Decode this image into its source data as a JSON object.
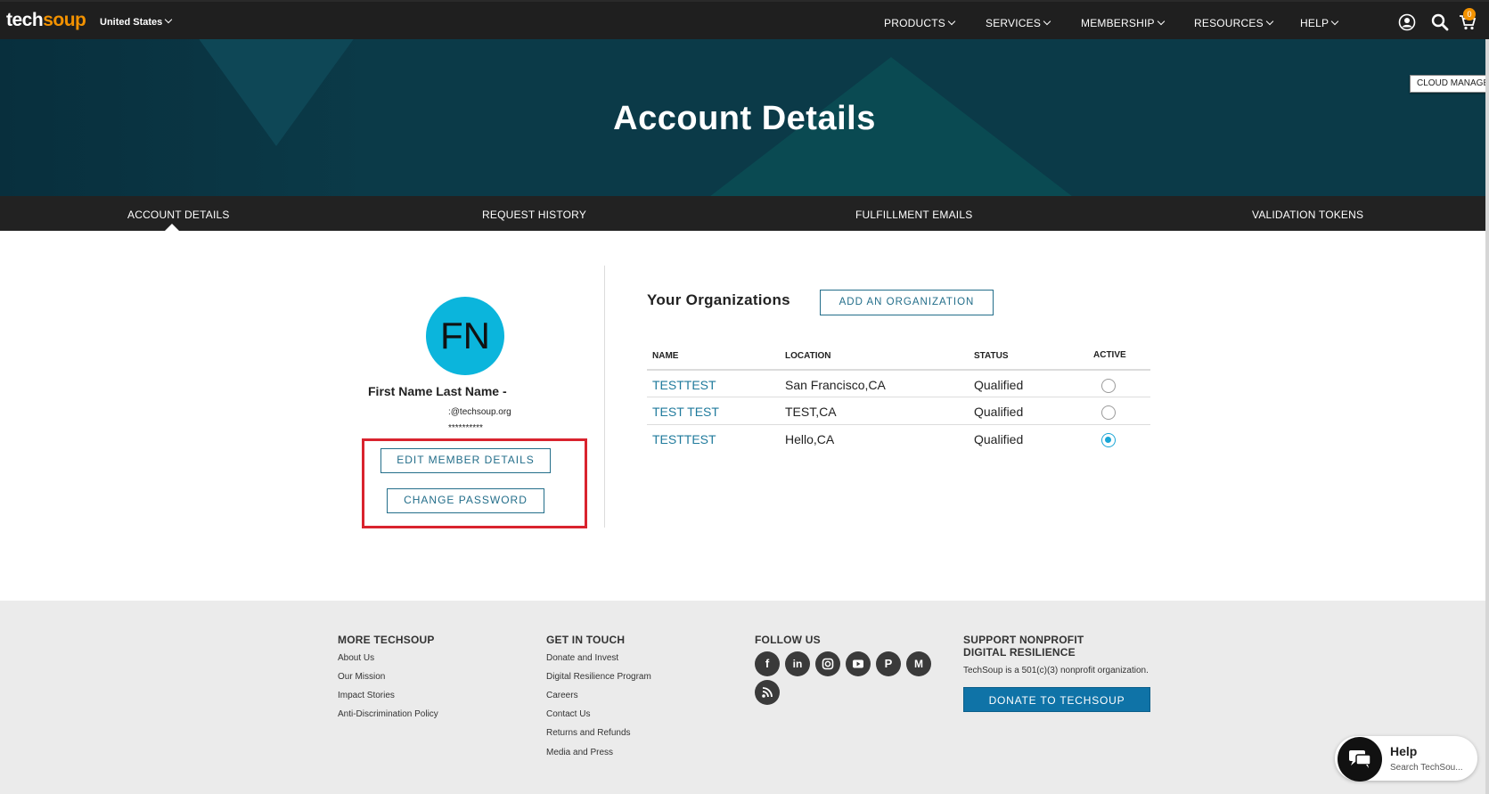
{
  "topnav": {
    "logo_tech": "tech",
    "logo_soup": "soup",
    "country": "United States",
    "items": [
      {
        "label": "PRODUCTS"
      },
      {
        "label": "SERVICES"
      },
      {
        "label": "MEMBERSHIP"
      },
      {
        "label": "RESOURCES"
      },
      {
        "label": "HELP"
      }
    ],
    "icons": [
      "user-icon",
      "search-icon",
      "cart-icon"
    ],
    "cart_count": "0"
  },
  "hero": {
    "title": "Account Details",
    "cloud_manager": "CLOUD MANAGER"
  },
  "subtabs": [
    {
      "label": "ACCOUNT DETAILS",
      "active": true
    },
    {
      "label": "REQUEST HISTORY"
    },
    {
      "label": "FULFILLMENT EMAILS"
    },
    {
      "label": "VALIDATION TOKENS"
    }
  ],
  "profile": {
    "initials": "FN",
    "name": "First Name Last Name -",
    "email": ":@techsoup.org",
    "password_mask": "**********",
    "edit_label": "EDIT MEMBER DETAILS",
    "change_password_label": "CHANGE PASSWORD"
  },
  "organizations": {
    "title": "Your Organizations",
    "add_label": "ADD AN ORGANIZATION",
    "columns": [
      "NAME",
      "LOCATION",
      "STATUS",
      "ACTIVE"
    ],
    "rows": [
      {
        "name": "TESTTEST",
        "location": "San Francisco,CA",
        "status": "Qualified",
        "active": false
      },
      {
        "name": "TEST TEST",
        "location": "TEST,CA",
        "status": "Qualified",
        "active": false
      },
      {
        "name": "TESTTEST",
        "location": "Hello,CA",
        "status": "Qualified",
        "active": true
      }
    ]
  },
  "footer": {
    "more": {
      "title": "MORE TECHSOUP",
      "links": [
        "About Us",
        "Our Mission",
        "Impact Stories",
        "Anti-Discrimination Policy"
      ]
    },
    "contact": {
      "title": "GET IN TOUCH",
      "links": [
        "Donate and Invest",
        "Digital Resilience Program",
        "Careers",
        "Contact Us",
        "Returns and Refunds",
        "Media and Press"
      ]
    },
    "follow": {
      "title": "FOLLOW US",
      "icons": [
        "facebook-icon",
        "linkedin-icon",
        "instagram-icon",
        "youtube-icon",
        "pinterest-icon",
        "medium-icon",
        "rss-icon"
      ]
    },
    "support": {
      "title_line1": "SUPPORT NONPROFIT",
      "title_line2": "DIGITAL RESILIENCE",
      "text": "TechSoup is a 501(c)(3) nonprofit organization.",
      "donate_label": "DONATE TO TECHSOUP"
    }
  },
  "help_widget": {
    "title": "Help",
    "subtitle": "Search TechSou..."
  },
  "colors": {
    "brand_orange": "#f39200",
    "accent_blue": "#236e8a",
    "avatar_cyan": "#0bb5dc",
    "highlight_red": "#d9232e",
    "donate_blue": "#0f73a7"
  }
}
